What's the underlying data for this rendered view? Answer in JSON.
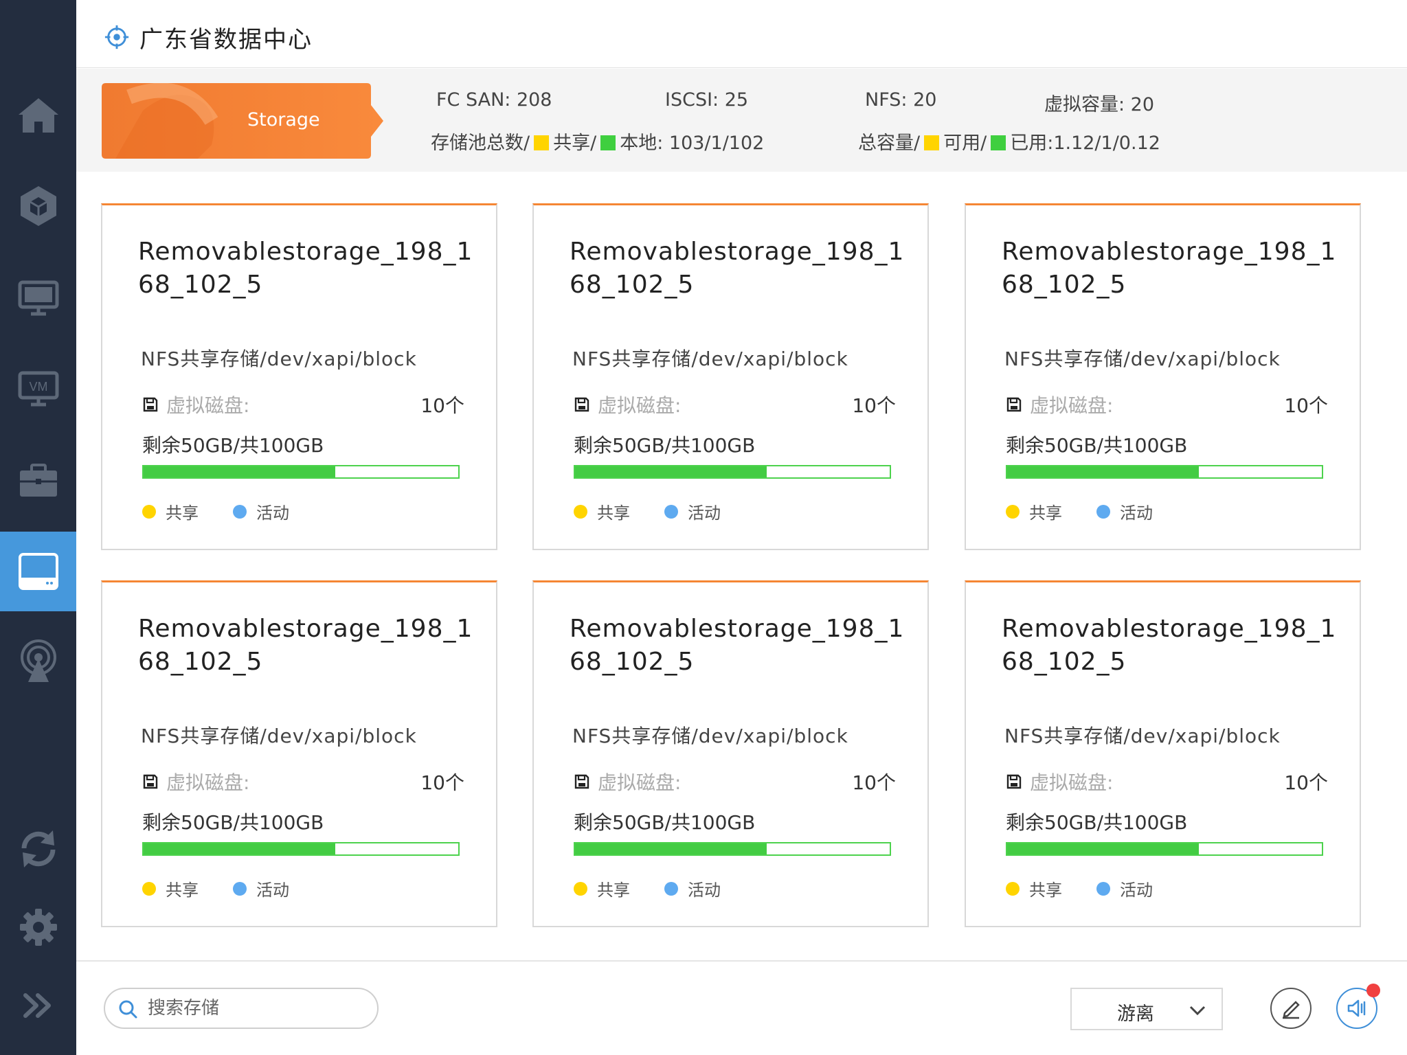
{
  "header": {
    "title": "广东省数据中心",
    "icon": "target-icon"
  },
  "sidebar": {
    "items": [
      {
        "name": "home",
        "icon": "home-icon",
        "active": false
      },
      {
        "name": "cube",
        "icon": "cube-icon",
        "active": false
      },
      {
        "name": "monitor",
        "icon": "monitor-icon",
        "active": false
      },
      {
        "name": "vm",
        "icon": "vm-icon",
        "label": "VM",
        "active": false
      },
      {
        "name": "briefcase",
        "icon": "briefcase-icon",
        "active": false
      },
      {
        "name": "storage",
        "icon": "storage-icon",
        "active": true
      },
      {
        "name": "broadcast",
        "icon": "broadcast-icon",
        "active": false
      },
      {
        "name": "refresh",
        "icon": "refresh-icon",
        "active": false
      },
      {
        "name": "settings",
        "icon": "gear-icon",
        "active": false
      },
      {
        "name": "expand",
        "icon": "double-chevron-right-icon",
        "active": false
      }
    ]
  },
  "summary": {
    "badge_label": "Storage",
    "fc_san": "FC SAN:  208",
    "iscsi": "ISCSI:  25",
    "nfs": "NFS:  20",
    "virtual_capacity": "虚拟容量:  20",
    "pool_prefix": "存储池总数/",
    "pool_shared": "共享/",
    "pool_local": "本地:  103/1/102",
    "total_prefix": "总容量/",
    "total_available": "可用/",
    "total_used": "已用:1.12/1/0.12",
    "colors": {
      "shared": "#ffd400",
      "local": "#3fcf3f",
      "accent": "#f58634"
    }
  },
  "cards": [
    {
      "name": "Removablestorage_198_168_102_5",
      "path": "NFS共享存储/dev/xapi/block",
      "disk_label": "虚拟磁盘:",
      "disk_count": "10个",
      "capacity": "剩余50GB/共100GB",
      "used_fraction": 0.61,
      "legend_shared": "共享",
      "legend_active": "活动"
    },
    {
      "name": "Removablestorage_198_168_102_5",
      "path": "NFS共享存储/dev/xapi/block",
      "disk_label": "虚拟磁盘:",
      "disk_count": "10个",
      "capacity": "剩余50GB/共100GB",
      "used_fraction": 0.61,
      "legend_shared": "共享",
      "legend_active": "活动"
    },
    {
      "name": "Removablestorage_198_168_102_5",
      "path": "NFS共享存储/dev/xapi/block",
      "disk_label": "虚拟磁盘:",
      "disk_count": "10个",
      "capacity": "剩余50GB/共100GB",
      "used_fraction": 0.61,
      "legend_shared": "共享",
      "legend_active": "活动"
    },
    {
      "name": "Removablestorage_198_168_102_5",
      "path": "NFS共享存储/dev/xapi/block",
      "disk_label": "虚拟磁盘:",
      "disk_count": "10个",
      "capacity": "剩余50GB/共100GB",
      "used_fraction": 0.61,
      "legend_shared": "共享",
      "legend_active": "活动"
    },
    {
      "name": "Removablestorage_198_168_102_5",
      "path": "NFS共享存储/dev/xapi/block",
      "disk_label": "虚拟磁盘:",
      "disk_count": "10个",
      "capacity": "剩余50GB/共100GB",
      "used_fraction": 0.61,
      "legend_shared": "共享",
      "legend_active": "活动"
    },
    {
      "name": "Removablestorage_198_168_102_5",
      "path": "NFS共享存储/dev/xapi/block",
      "disk_label": "虚拟磁盘:",
      "disk_count": "10个",
      "capacity": "剩余50GB/共100GB",
      "used_fraction": 0.61,
      "legend_shared": "共享",
      "legend_active": "活动"
    }
  ],
  "footer": {
    "search_placeholder": "搜索存储",
    "filter_value": "游离",
    "edit_icon": "edit-icon",
    "sound_icon": "speaker-icon"
  }
}
